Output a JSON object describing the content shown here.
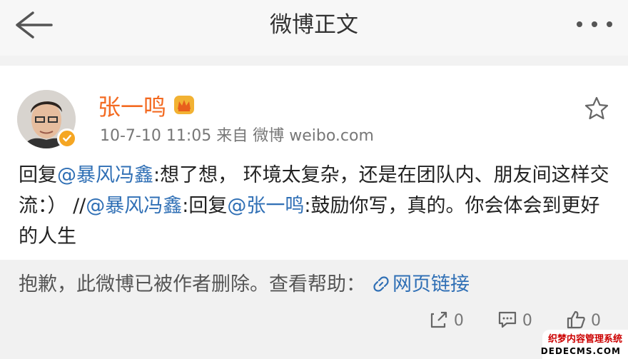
{
  "header": {
    "title": "微博正文"
  },
  "post": {
    "username": "张一鸣",
    "meta": "10-7-10 11:05  来自 微博 weibo.com",
    "content": [
      {
        "text": "回复",
        "mention": false
      },
      {
        "text": "@暴风冯鑫",
        "mention": true
      },
      {
        "text": ":想了想， 环境太复杂，还是在团队内、朋友间这样交流：）  //",
        "mention": false
      },
      {
        "text": "@暴风冯鑫",
        "mention": true
      },
      {
        "text": ":回复",
        "mention": false
      },
      {
        "text": "@张一鸣",
        "mention": true
      },
      {
        "text": ":鼓励你写，真的。你会体会到更好的人生",
        "mention": false
      }
    ]
  },
  "deleted": {
    "message": "抱歉，此微博已被作者删除。查看帮助：",
    "link_text": "网页链接"
  },
  "actions": {
    "repost_count": "0",
    "comment_count": "0",
    "like_count": "0"
  },
  "watermark": {
    "line1": "织梦内容管理系统",
    "line2": "DEDECMS.COM"
  },
  "colors": {
    "username": "#f36a21",
    "mention": "#2f6fb5",
    "badge": "#f5a623"
  }
}
